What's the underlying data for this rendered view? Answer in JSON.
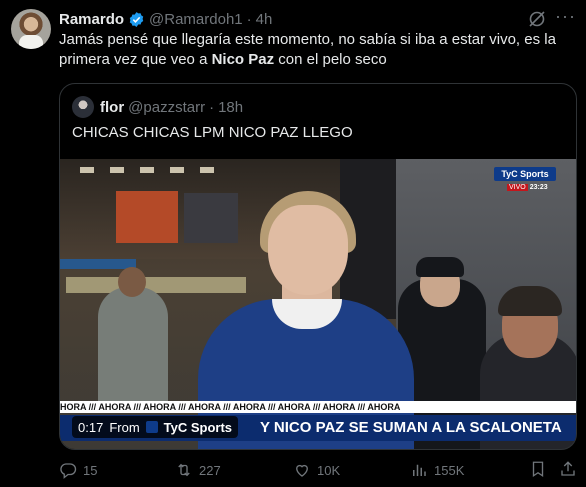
{
  "tweet": {
    "author_name": "Ramardo",
    "handle": "@Ramardoh1",
    "separator": "·",
    "time": "4h",
    "text_part1": "Jamás pensé que llegaría este momento, no sabía si iba a estar vivo, es la primera vez que veo a ",
    "text_bold": "Nico Paz",
    "text_part2": " con el pelo seco"
  },
  "quote": {
    "author_name": "flor",
    "handle": "@pazzstarr",
    "separator": "·",
    "time": "18h",
    "text": "CHICAS CHICAS LPM NICO PAZ LLEGO",
    "video": {
      "duration": "0:17",
      "from_label": "From",
      "source": "TyC Sports",
      "channel_logo": "TyC Sports",
      "live_label": "VIVO",
      "live_time": "23:23",
      "ticker": "HORA   ///   AHORA   ///   AHORA   ///   AHORA   ///   AHORA   ///   AHORA   ///   AHORA   ///   AHORA",
      "headline": "Y NICO PAZ SE SUMAN A LA SCALONETA"
    }
  },
  "actions": {
    "replies": "15",
    "retweets": "227",
    "likes": "10K",
    "views": "155K"
  },
  "colors": {
    "background": "#000000",
    "text": "#e7e9ea",
    "muted": "#71767b",
    "verified": "#1d9bf0",
    "border": "#2f3336"
  }
}
